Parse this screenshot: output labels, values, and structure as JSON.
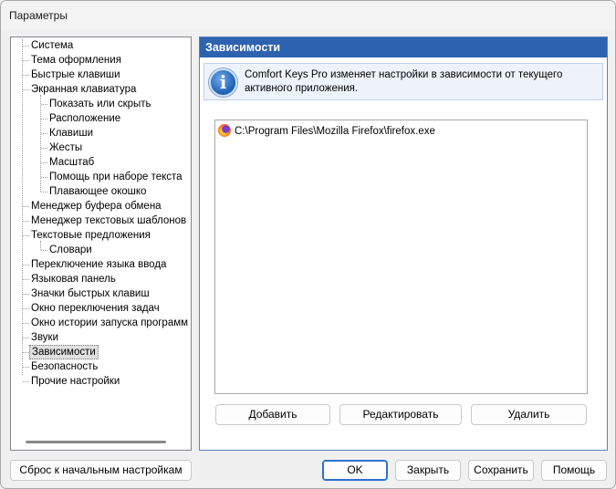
{
  "window": {
    "title": "Параметры"
  },
  "tree": {
    "items": [
      {
        "label": "Система",
        "level": 0
      },
      {
        "label": "Тема оформления",
        "level": 0
      },
      {
        "label": "Быстрые клавиши",
        "level": 0
      },
      {
        "label": "Экранная клавиатура",
        "level": 0
      },
      {
        "label": "Показать или скрыть",
        "level": 1
      },
      {
        "label": "Расположение",
        "level": 1
      },
      {
        "label": "Клавиши",
        "level": 1
      },
      {
        "label": "Жесты",
        "level": 1
      },
      {
        "label": "Масштаб",
        "level": 1
      },
      {
        "label": "Помощь при наборе текста",
        "level": 1
      },
      {
        "label": "Плавающее окошко",
        "level": 1
      },
      {
        "label": "Менеджер буфера обмена",
        "level": 0
      },
      {
        "label": "Менеджер текстовых шаблонов",
        "level": 0
      },
      {
        "label": "Текстовые предложения",
        "level": 0
      },
      {
        "label": "Словари",
        "level": 1
      },
      {
        "label": "Переключение языка ввода",
        "level": 0
      },
      {
        "label": "Языковая панель",
        "level": 0
      },
      {
        "label": "Значки быстрых клавиш",
        "level": 0
      },
      {
        "label": "Окно переключения задач",
        "level": 0
      },
      {
        "label": "Окно истории запуска программ",
        "level": 0
      },
      {
        "label": "Звуки",
        "level": 0
      },
      {
        "label": "Зависимости",
        "level": 0,
        "selected": true
      },
      {
        "label": "Безопасность",
        "level": 0
      },
      {
        "label": "Прочие настройки",
        "level": 0
      }
    ]
  },
  "panel": {
    "header": "Зависимости",
    "info": "Comfort Keys Pro изменяет настройки в зависимости от текущего активного приложения.",
    "list_items": [
      {
        "path": "C:\\Program Files\\Mozilla Firefox\\firefox.exe",
        "icon": "firefox-icon"
      }
    ],
    "buttons": {
      "add": "Добавить",
      "edit": "Редактировать",
      "delete": "Удалить"
    }
  },
  "footer": {
    "reset": "Сброс к начальным настройкам",
    "ok": "OK",
    "close": "Закрыть",
    "save": "Сохранить",
    "help": "Помощь"
  }
}
